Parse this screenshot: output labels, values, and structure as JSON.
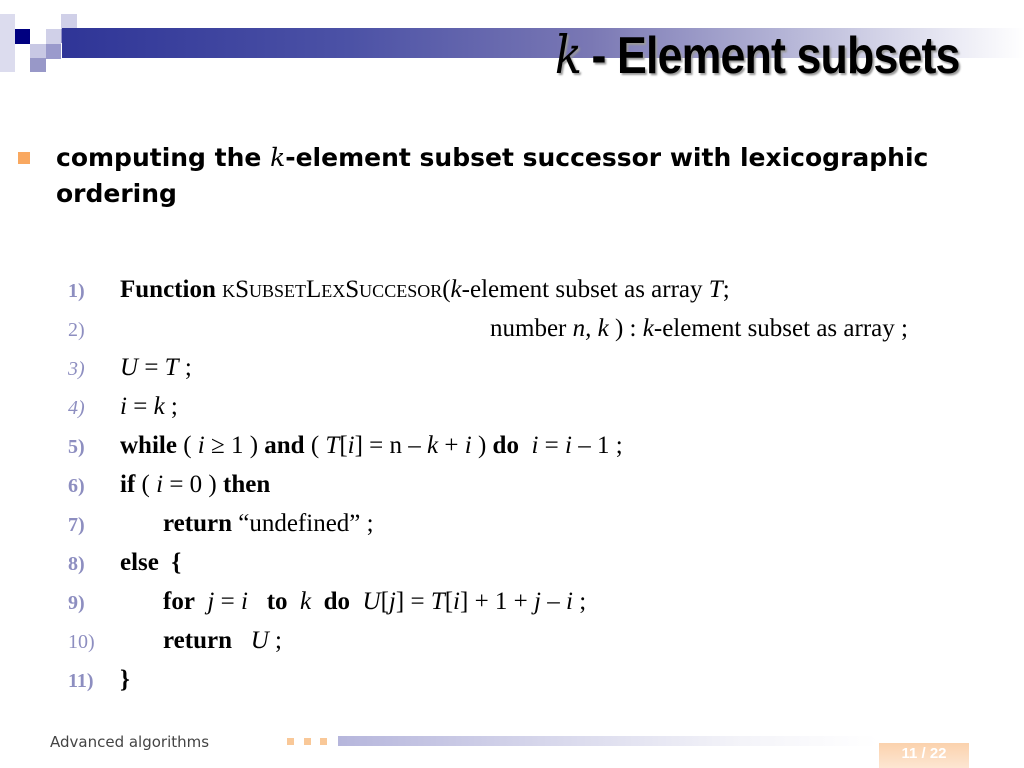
{
  "title": {
    "k": "k",
    "text": "- Element subsets"
  },
  "intro": {
    "pre": "computing the ",
    "k": "k",
    "post": "-element subset successor with lexicographic ordering"
  },
  "code": {
    "numbers": [
      "1)",
      "2)",
      "3)",
      "4)",
      "5)",
      "6)",
      "7)",
      "8)",
      "9)",
      "10)",
      "11)"
    ],
    "line1": {
      "kw": "Function",
      "name": "kSubsetLexSuccesor",
      "args": "(",
      "k": "k",
      "rest": "-element subset as array ",
      "T": "T",
      "end": ";"
    },
    "line2": {
      "a": "number ",
      "nk": "n, k",
      "b": " ) : ",
      "k": "k",
      "c": "-element subset as array ;"
    },
    "line3": {
      "U": "U",
      "eq": " = ",
      "T": "T",
      "end": " ;"
    },
    "line4": {
      "i": "i",
      "eq": " = ",
      "k": "k",
      "end": " ;"
    },
    "line5": {
      "kw1": "while",
      "p1": " ( ",
      "cond1": "i",
      "c1": " ≥ 1 ) ",
      "kw2": "and",
      "p2": " ( ",
      "T": "T",
      "br": "[",
      "i": "i",
      "br2": "] = n – ",
      "k": "k",
      "plus": " + ",
      "i2": "i",
      "close": " ) ",
      "kw3": "do",
      "sp": "  ",
      "asg": "i",
      "eq": " = ",
      "asg2": "i",
      "end": " – 1 ;"
    },
    "line6": {
      "kw1": "if",
      "p": " ( ",
      "i": "i",
      "c": " = 0 ) ",
      "kw2": "then"
    },
    "line7": {
      "kw": "return",
      "text": " “undefined” ;"
    },
    "line8": {
      "kw": "else",
      "text": "  {"
    },
    "line9": {
      "kw1": "for",
      "j": "j",
      "eq": " = ",
      "i": "i",
      "kw2": "to",
      "k": "k",
      "kw3": "do",
      "U": "U",
      "j2": "j",
      "rhs1": "] = ",
      "T": "T",
      "i2": "i",
      "rhs2": "] + 1 + ",
      "j3": "j",
      "minus": " – ",
      "i3": "i",
      "end": " ;"
    },
    "line10": {
      "kw": "return",
      "U": "U",
      "end": " ;"
    },
    "line11": {
      "text": "}"
    }
  },
  "footer": {
    "course": "Advanced algorithms",
    "page": "11 / 22"
  },
  "colors": {
    "accent_orange": "#f9a860",
    "band_blue": "#2f3597",
    "line_number": "#8d8ec0"
  }
}
